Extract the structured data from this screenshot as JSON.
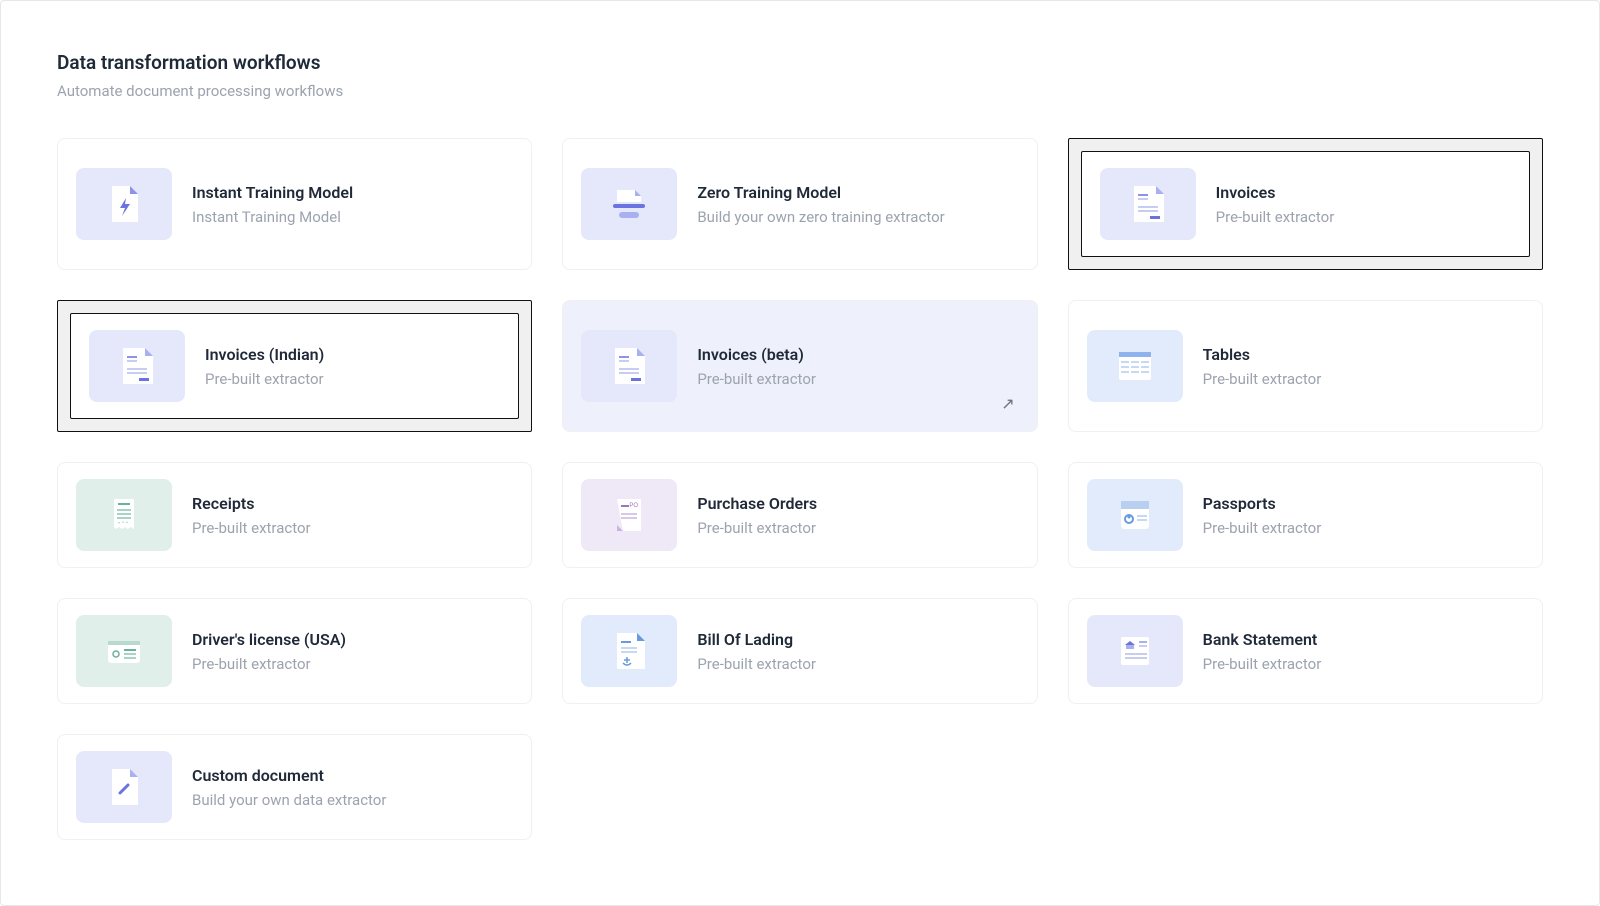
{
  "header": {
    "title": "Data transformation workflows",
    "subtitle": "Automate document processing workflows"
  },
  "cards": [
    {
      "title": "Instant Training Model",
      "desc": "Instant Training Model"
    },
    {
      "title": "Zero Training Model",
      "desc": "Build your own zero training extractor"
    },
    {
      "title": "Invoices",
      "desc": "Pre-built extractor"
    },
    {
      "title": "Invoices (Indian)",
      "desc": "Pre-built extractor"
    },
    {
      "title": "Invoices (beta)",
      "desc": "Pre-built extractor"
    },
    {
      "title": "Tables",
      "desc": "Pre-built extractor"
    },
    {
      "title": "Receipts",
      "desc": "Pre-built extractor"
    },
    {
      "title": "Purchase Orders",
      "desc": "Pre-built extractor"
    },
    {
      "title": "Passports",
      "desc": "Pre-built extractor"
    },
    {
      "title": "Driver's license (USA)",
      "desc": "Pre-built extractor"
    },
    {
      "title": "Bill Of Lading",
      "desc": "Pre-built extractor"
    },
    {
      "title": "Bank Statement",
      "desc": "Pre-built extractor"
    },
    {
      "title": "Custom document",
      "desc": "Build your own data extractor"
    }
  ]
}
